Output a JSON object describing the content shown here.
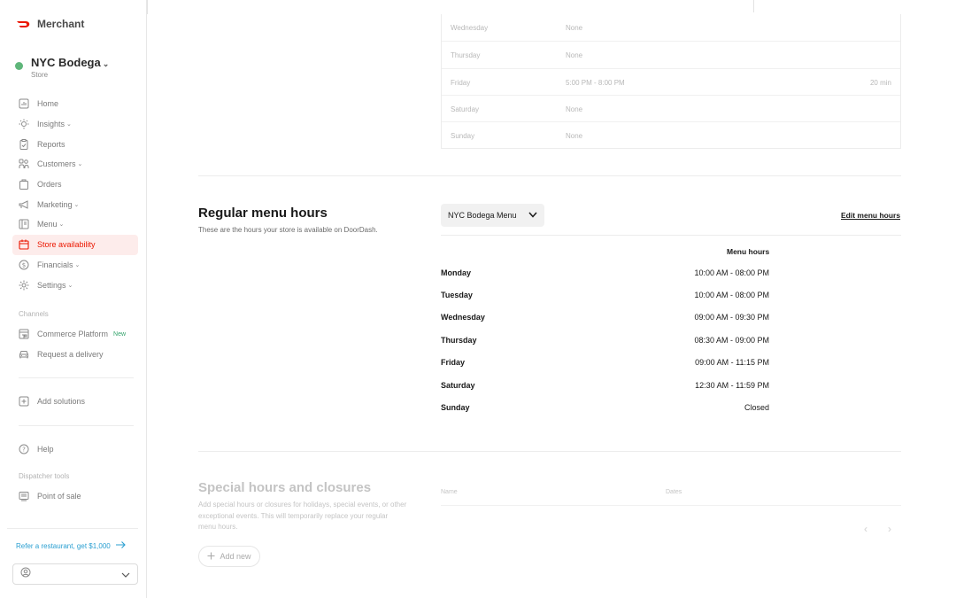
{
  "brand": {
    "name": "Merchant",
    "color": "#eb1700"
  },
  "store": {
    "name": "NYC Bodega",
    "type": "Store",
    "status_color": "#5fb67a"
  },
  "nav": [
    {
      "label": "Home",
      "icon": "chart-icon",
      "chevron": false
    },
    {
      "label": "Insights",
      "icon": "lightbulb-icon",
      "chevron": true
    },
    {
      "label": "Reports",
      "icon": "clipboard-icon",
      "chevron": false
    },
    {
      "label": "Customers",
      "icon": "people-icon",
      "chevron": true
    },
    {
      "label": "Orders",
      "icon": "bag-icon",
      "chevron": false
    },
    {
      "label": "Marketing",
      "icon": "megaphone-icon",
      "chevron": true
    },
    {
      "label": "Menu",
      "icon": "menu-book-icon",
      "chevron": true
    },
    {
      "label": "Store availability",
      "icon": "calendar-icon",
      "chevron": false,
      "active": true
    },
    {
      "label": "Financials",
      "icon": "dollar-icon",
      "chevron": true
    },
    {
      "label": "Settings",
      "icon": "gear-icon",
      "chevron": true
    }
  ],
  "channels": {
    "label": "Channels",
    "items": [
      {
        "label": "Commerce Platform",
        "badge": "New",
        "icon": "storefront-icon"
      },
      {
        "label": "Request a delivery",
        "icon": "car-icon"
      }
    ]
  },
  "add_solutions": {
    "label": "Add solutions",
    "icon": "plus-square-icon"
  },
  "help": {
    "label": "Help",
    "icon": "question-icon"
  },
  "dispatcher": {
    "label": "Dispatcher tools",
    "items": [
      {
        "label": "Point of sale",
        "icon": "pos-icon"
      }
    ]
  },
  "refer": {
    "label": "Refer a restaurant, get $1,000"
  },
  "top_table": {
    "rows": [
      {
        "day": "Wednesday",
        "hours": "None",
        "eta": ""
      },
      {
        "day": "Thursday",
        "hours": "None",
        "eta": ""
      },
      {
        "day": "Friday",
        "hours": "5:00 PM - 8:00 PM",
        "eta": "20 min"
      },
      {
        "day": "Saturday",
        "hours": "None",
        "eta": ""
      },
      {
        "day": "Sunday",
        "hours": "None",
        "eta": ""
      }
    ]
  },
  "regular_hours": {
    "title": "Regular menu hours",
    "subtitle": "These are the hours your store is available on DoorDash.",
    "menu_select": "NYC Bodega Menu",
    "edit_link": "Edit menu hours",
    "column_header": "Menu hours",
    "rows": [
      {
        "day": "Monday",
        "hours": "10:00 AM - 08:00 PM"
      },
      {
        "day": "Tuesday",
        "hours": "10:00 AM - 08:00 PM"
      },
      {
        "day": "Wednesday",
        "hours": "09:00 AM - 09:30 PM"
      },
      {
        "day": "Thursday",
        "hours": "08:30 AM - 09:00 PM"
      },
      {
        "day": "Friday",
        "hours": "09:00 AM - 11:15 PM"
      },
      {
        "day": "Saturday",
        "hours": "12:30 AM - 11:59 PM"
      },
      {
        "day": "Sunday",
        "hours": "Closed"
      }
    ]
  },
  "special_hours": {
    "title": "Special hours and closures",
    "description": "Add special hours or closures for holidays, special events, or other exceptional events. This will temporarily replace your regular menu hours.",
    "add_button": "Add new",
    "columns": {
      "name": "Name",
      "dates": "Dates"
    }
  }
}
